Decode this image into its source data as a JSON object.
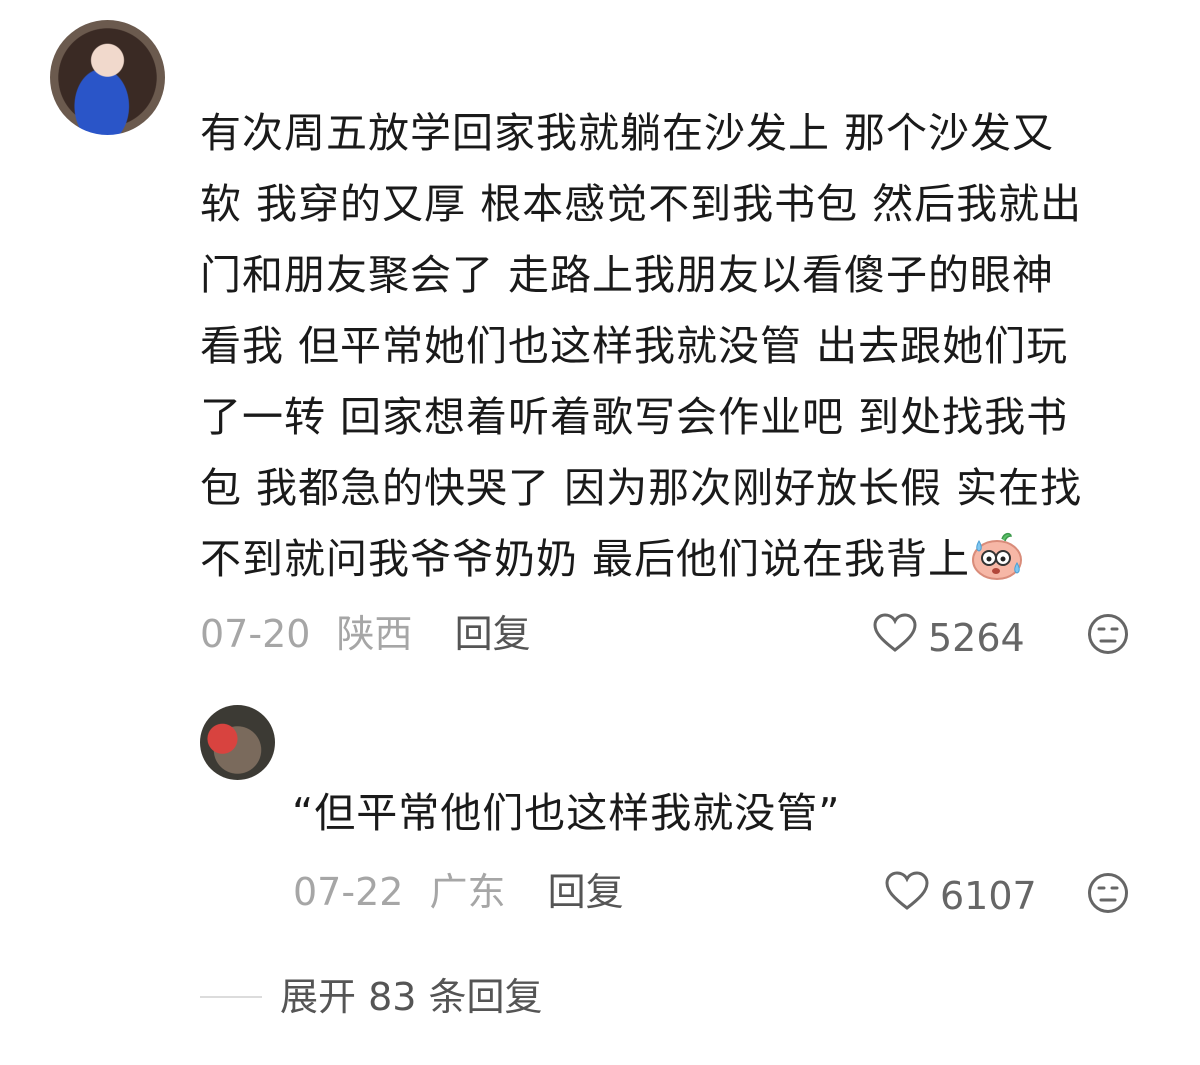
{
  "comment": {
    "lines": [
      "有次周五放学回家我就躺在沙发上 那个沙发又",
      "软 我穿的又厚 根本感觉不到我书包 然后我就出",
      "门和朋友聚会了 走路上我朋友以看傻子的眼神",
      "看我 但平常她们也这样我就没管 出去跟她们玩",
      "了一转 回家想着听着歌写会作业吧 到处找我书",
      "包 我都急的快哭了 因为那次刚好放长假 实在找",
      "不到就问我爷爷奶奶 最后他们说在我背上"
    ],
    "emoji_icon": "sweating-face-emoji-icon",
    "date": "07-20",
    "location": "陕西",
    "reply_label": "回复",
    "likes": "5264"
  },
  "reply": {
    "text": "“但平常他们也这样我就没管”",
    "date": "07-22",
    "location": "广东",
    "reply_label": "回复",
    "likes": "6107"
  },
  "expand_label": "展开 83 条回复",
  "icons": {
    "like": "heart-outline-icon",
    "dislike": "unhappy-face-icon"
  },
  "colors": {
    "text": "#1a1a1a",
    "meta_gray": "#a6a6a6",
    "icon_gray": "#666666"
  }
}
